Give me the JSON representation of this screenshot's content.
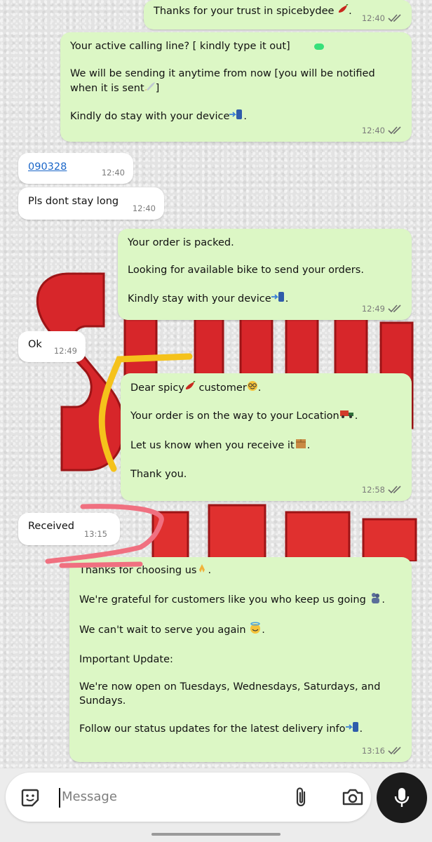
{
  "chat": {
    "messages": [
      {
        "lines": [
          "Thanks for your trust in spicebydee"
        ],
        "time": "12:40"
      },
      {
        "lines": [
          "Your active calling line? [ kindly type it out]",
          "We will be sending it anytime from now [you will be notified when it is sent",
          "Kindly do stay with your device"
        ],
        "time": "12:40"
      },
      {
        "lines": [
          "090328"
        ],
        "time": "12:40"
      },
      {
        "lines": [
          "Pls dont stay long"
        ],
        "time": "12:40"
      },
      {
        "lines": [
          "Your order is packed.",
          "Looking for available bike to send your orders.",
          "Kindly stay with your device"
        ],
        "time": "12:49"
      },
      {
        "lines": [
          "Ok"
        ],
        "time": "12:49"
      },
      {
        "lines": [
          "Dear spicy",
          "customer",
          "Your order is on the way to your Location",
          "Let us know when you receive it",
          "Thank you."
        ],
        "time": "12:58"
      },
      {
        "lines": [
          "Received"
        ],
        "time": "13:15"
      },
      {
        "lines": [
          "Thanks for choosing us",
          "We're grateful for customers like you who keep us going",
          "We can't wait to serve you again",
          "Important Update:",
          "We're now open on Tuesdays, Wednesdays, Saturdays, and Sundays.",
          "Follow our status updates for the latest delivery info"
        ],
        "time": "13:16"
      }
    ]
  },
  "composer": {
    "placeholder": "Message"
  },
  "colors": {
    "outgoing_bubble": "#dcf7c5",
    "incoming_bubble": "#ffffff",
    "mic_button": "#1b1b1b",
    "link": "#1a66c8"
  },
  "icons": [
    "double-check-icon",
    "sticker-icon",
    "paperclip-icon",
    "camera-icon",
    "microphone-icon",
    "chili-pepper-emoji",
    "rocket-emoji",
    "phone-arrow-emoji",
    "nerd-face-emoji",
    "delivery-truck-emoji",
    "package-emoji",
    "folded-hands-emoji",
    "smiling-halo-emoji"
  ]
}
